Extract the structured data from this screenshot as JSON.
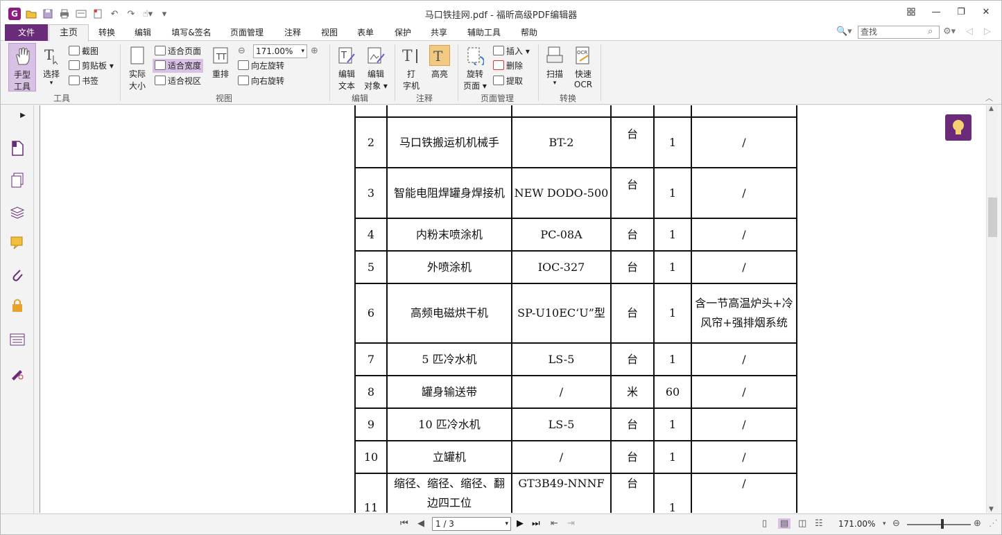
{
  "window": {
    "title": "马口铁挂网.pdf - 福昕高级PDF编辑器",
    "minimize_icon": "minimize-icon",
    "restore_icon": "restore-icon",
    "close_icon": "close-icon"
  },
  "menu": {
    "tabs": [
      "文件",
      "主页",
      "转换",
      "编辑",
      "填写&签名",
      "页面管理",
      "注释",
      "视图",
      "表单",
      "保护",
      "共享",
      "辅助工具",
      "帮助"
    ],
    "search_placeholder": "查找"
  },
  "ribbon": {
    "tools": {
      "hand_line1": "手型",
      "hand_line2": "工具",
      "select": "选择",
      "snapshot": "截图",
      "clipboard": "剪贴板",
      "bookmark": "书签",
      "group": "工具"
    },
    "view": {
      "actual_line1": "实际",
      "actual_line2": "大小",
      "fit_page": "适合页面",
      "fit_width": "适合宽度",
      "fit_visible": "适合视区",
      "reflow": "重排",
      "zoom_value": "171.00%",
      "rotate_left": "向左旋转",
      "rotate_right": "向右旋转",
      "group": "视图"
    },
    "edit": {
      "edit_text_line1": "编辑",
      "edit_text_line2": "文本",
      "edit_obj_line1": "编辑",
      "edit_obj_line2": "对象",
      "group": "编辑"
    },
    "comment": {
      "typewriter_line1": "打",
      "typewriter_line2": "字机",
      "highlight": "高亮",
      "group": "注释"
    },
    "pages": {
      "rotate_line1": "旋转",
      "rotate_line2": "页面",
      "insert": "插入",
      "delete": "删除",
      "extract": "提取",
      "group": "页面管理"
    },
    "convert": {
      "scan": "扫描",
      "ocr_line1": "快速",
      "ocr_line2": "OCR",
      "group": "转换"
    }
  },
  "table": {
    "rows": [
      {
        "no": "2",
        "name": "马口铁搬运机机械手",
        "model": "BT-2",
        "unit": "台",
        "qty": "1",
        "note": "/"
      },
      {
        "no": "3",
        "name": "智能电阻焊罐身焊接机",
        "model": "NEW DODO-500",
        "unit": "台",
        "qty": "1",
        "note": "/"
      },
      {
        "no": "4",
        "name": "内粉末喷涂机",
        "model": "PC-08A",
        "unit": "台",
        "qty": "1",
        "note": "/"
      },
      {
        "no": "5",
        "name": "外喷涂机",
        "model": "IOC-327",
        "unit": "台",
        "qty": "1",
        "note": "/"
      },
      {
        "no": "6",
        "name": "高频电磁烘干机",
        "model": "SP-U10EC‘U”型",
        "unit": "台",
        "qty": "1",
        "note": "含一节高温炉头+冷风帘+强排烟系统"
      },
      {
        "no": "7",
        "name": "5 匹冷水机",
        "model": "LS-5",
        "unit": "台",
        "qty": "1",
        "note": "/"
      },
      {
        "no": "8",
        "name": "罐身输送带",
        "model": "/",
        "unit": "米",
        "qty": "60",
        "note": "/"
      },
      {
        "no": "9",
        "name": "10 匹冷水机",
        "model": "LS-5",
        "unit": "台",
        "qty": "1",
        "note": "/"
      },
      {
        "no": "10",
        "name": "立罐机",
        "model": "/",
        "unit": "台",
        "qty": "1",
        "note": "/"
      },
      {
        "no": "11",
        "name": "缩径、缩径、缩径、翻边四工位",
        "model": "GT3B49-NNNF",
        "unit": "台",
        "qty": "1",
        "note": "/"
      }
    ]
  },
  "status": {
    "page": "1 / 3",
    "zoom": "171.00%"
  },
  "colors": {
    "brand": "#6a2c7a",
    "accent": "#d9c1e6"
  }
}
